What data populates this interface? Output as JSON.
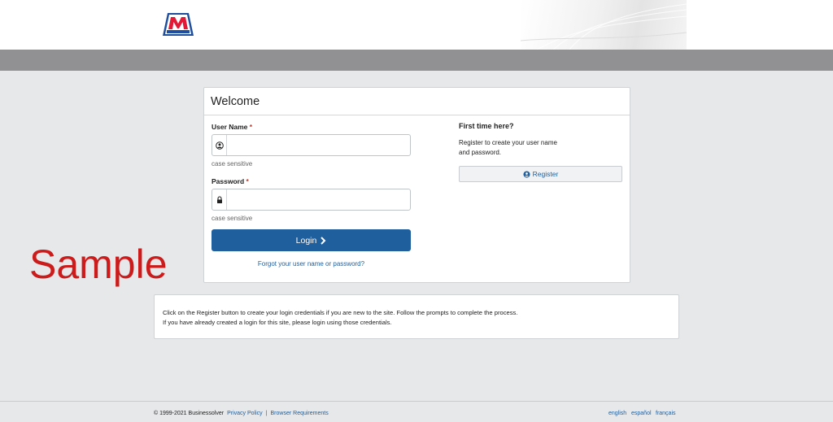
{
  "brand": {
    "logo_text": "MARATHON",
    "colors": {
      "red": "#e31837",
      "blue": "#1f5f9e"
    }
  },
  "panel": {
    "title": "Welcome",
    "username": {
      "label": "User Name",
      "required_mark": "*",
      "value": "",
      "hint": "case sensitive",
      "icon": "user-circle-icon"
    },
    "password": {
      "label": "Password",
      "required_mark": "*",
      "value": "",
      "hint": "case sensitive",
      "icon": "lock-icon"
    },
    "login_label": "Login",
    "forgot_label": "Forgot your user name or password?",
    "first_time": {
      "heading": "First time here?",
      "text": "Register to create your user name and password.",
      "register_label": "Register"
    }
  },
  "watermark": "Sample",
  "info": {
    "text": "Click on the Register button to create your login credentials if you are new to the site. Follow the prompts to complete the process. If you have already created a login for this site, please login using those credentials."
  },
  "footer": {
    "copyright": "© 1999-2021 Businessolver",
    "privacy_label": "Privacy Policy",
    "separator": "|",
    "browser_label": "Browser Requirements",
    "languages": [
      "english",
      "español",
      "français"
    ]
  }
}
